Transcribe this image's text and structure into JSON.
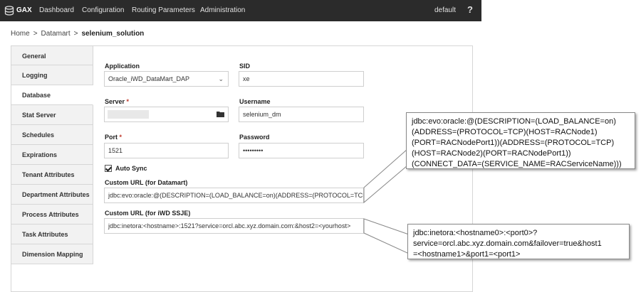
{
  "topbar": {
    "brand": "GAX",
    "nav": [
      "Dashboard",
      "Configuration",
      "Routing Parameters",
      "Administration"
    ],
    "user": "default",
    "help": "?"
  },
  "breadcrumb": {
    "home": "Home",
    "section": "Datamart",
    "current": "selenium_solution",
    "sep": ">"
  },
  "sidebar": {
    "items": [
      {
        "label": "General"
      },
      {
        "label": "Logging"
      },
      {
        "label": "Database"
      },
      {
        "label": "Stat Server"
      },
      {
        "label": "Schedules"
      },
      {
        "label": "Expirations"
      },
      {
        "label": "Tenant Attributes"
      },
      {
        "label": "Department Attributes"
      },
      {
        "label": "Process Attributes"
      },
      {
        "label": "Task Attributes"
      },
      {
        "label": "Dimension Mapping"
      }
    ],
    "active": "Database"
  },
  "form": {
    "application": {
      "label": "Application",
      "value": "Oracle_iWD_DataMart_DAP"
    },
    "sid": {
      "label": "SID",
      "value": "xe"
    },
    "server": {
      "label": "Server",
      "required": "*",
      "value": ""
    },
    "username": {
      "label": "Username",
      "value": "selenium_dm"
    },
    "port": {
      "label": "Port",
      "required": "*",
      "value": "1521"
    },
    "password": {
      "label": "Password",
      "value": "•••••••••"
    },
    "auto_sync": {
      "label": "Auto Sync",
      "checked": true
    },
    "custom_url_datamart": {
      "label": "Custom URL (for Datamart)",
      "value": "jdbc:evo:oracle:@(DESCRIPTION=(LOAD_BALANCE=on)(ADDRESS=(PROTOCOL=TCP)(HOST=RACNode1)(PORT=RACNodePort1))(ADDRESS=(PROTOCOL=TCP)(HOST=RACNode2)(PORT=RACNodePort1))(CONNECT_DATA=(SERVICE_NAME=RACServiceName)))"
    },
    "custom_url_ssje": {
      "label": "Custom URL (for iWD SSJE)",
      "value": "jdbc:inetora:<hostname>:1521?service=orcl.abc.xyz.domain.com:&host2=<yourhost>"
    }
  },
  "callouts": {
    "datamart": [
      "jdbc:evo:oracle:@(DESCRIPTION=(LOAD_BALANCE=on)",
      "(ADDRESS=(PROTOCOL=TCP)(HOST=RACNode1)",
      "(PORT=RACNodePort1))(ADDRESS=(PROTOCOL=TCP)",
      "(HOST=RACNode2)(PORT=RACNodePort1))",
      "(CONNECT_DATA=(SERVICE_NAME=RACServiceName)))"
    ],
    "ssje": [
      "jdbc:inetora:<hostname0>:<port0>?",
      "service=orcl.abc.xyz.domain.com&failover=true&host1",
      "=<hostname1>&port1=<port1>"
    ]
  },
  "icons": {
    "logo": "database-stack-icon",
    "chevron": "chevron-down-icon",
    "folder": "folder-icon",
    "check": "checkmark-icon"
  },
  "colors": {
    "topbar": "#2b2b2b",
    "required": "#c0392b",
    "sidebar_bg": "#f2f2f2"
  }
}
